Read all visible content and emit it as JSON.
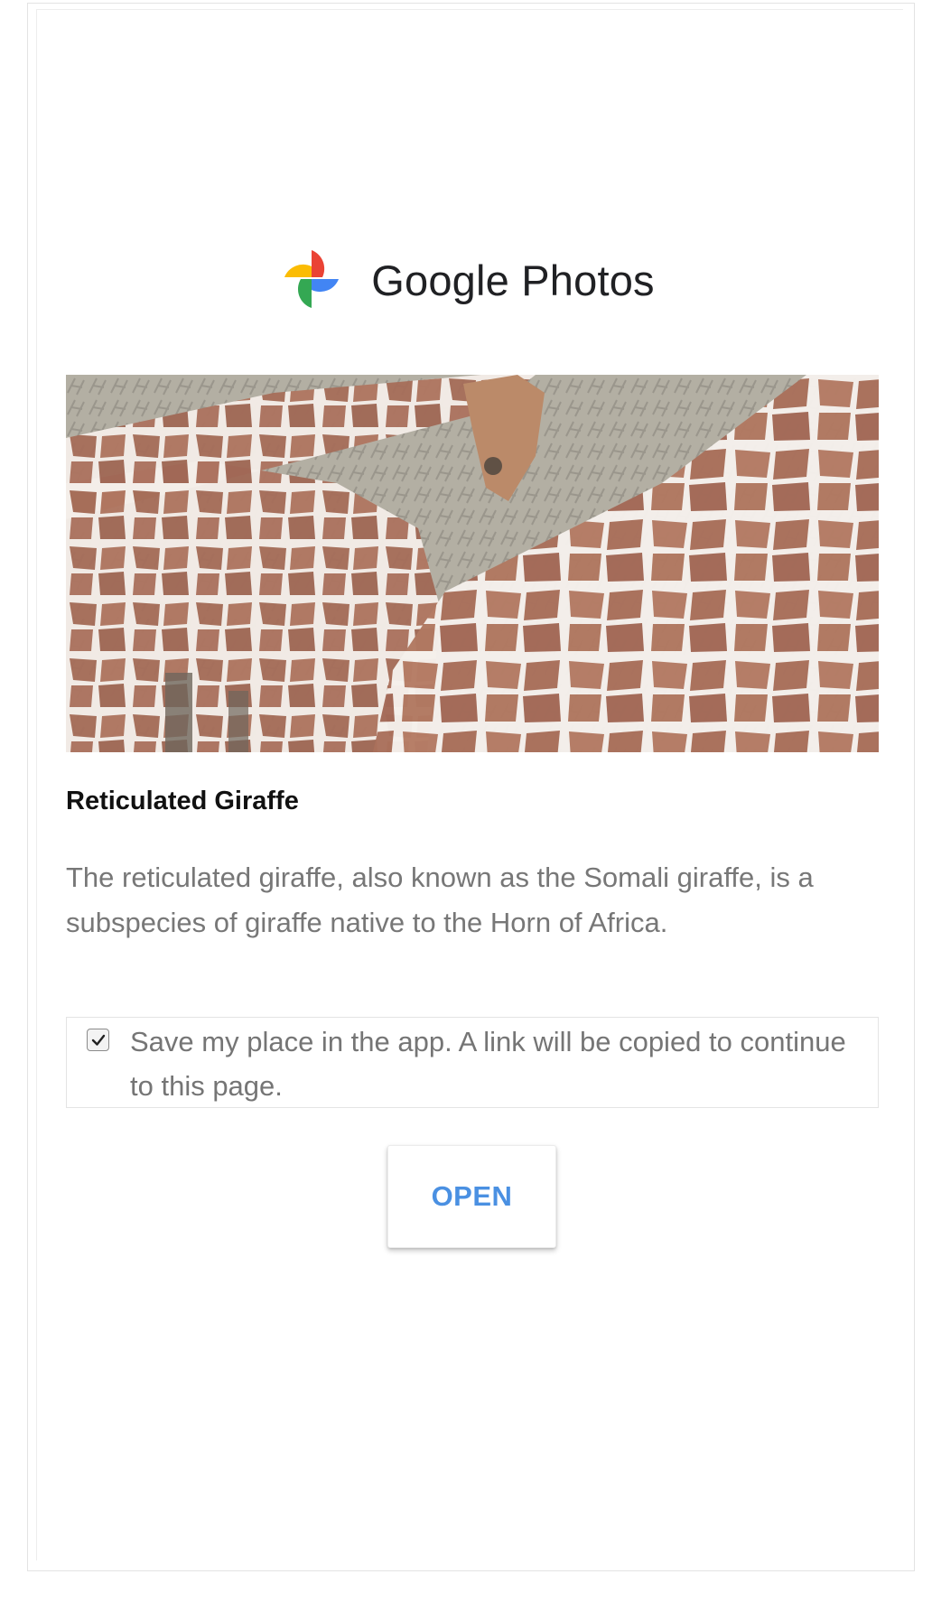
{
  "header": {
    "app_name": "Google Photos",
    "logo_icon": "google-photos-pinwheel-icon"
  },
  "card": {
    "image_icon": "giraffe-photo",
    "title": "Reticulated Giraffe",
    "description": "The reticulated giraffe, also known as the Somali giraffe, is a subspecies of giraffe native to the Horn of Africa."
  },
  "save_option": {
    "checked": true,
    "label": "Save my place in the app. A link will be copied to continue to this page."
  },
  "actions": {
    "open_label": "OPEN"
  },
  "colors": {
    "accent": "#4a90e2",
    "title_text": "#111111",
    "body_text": "#777777"
  }
}
